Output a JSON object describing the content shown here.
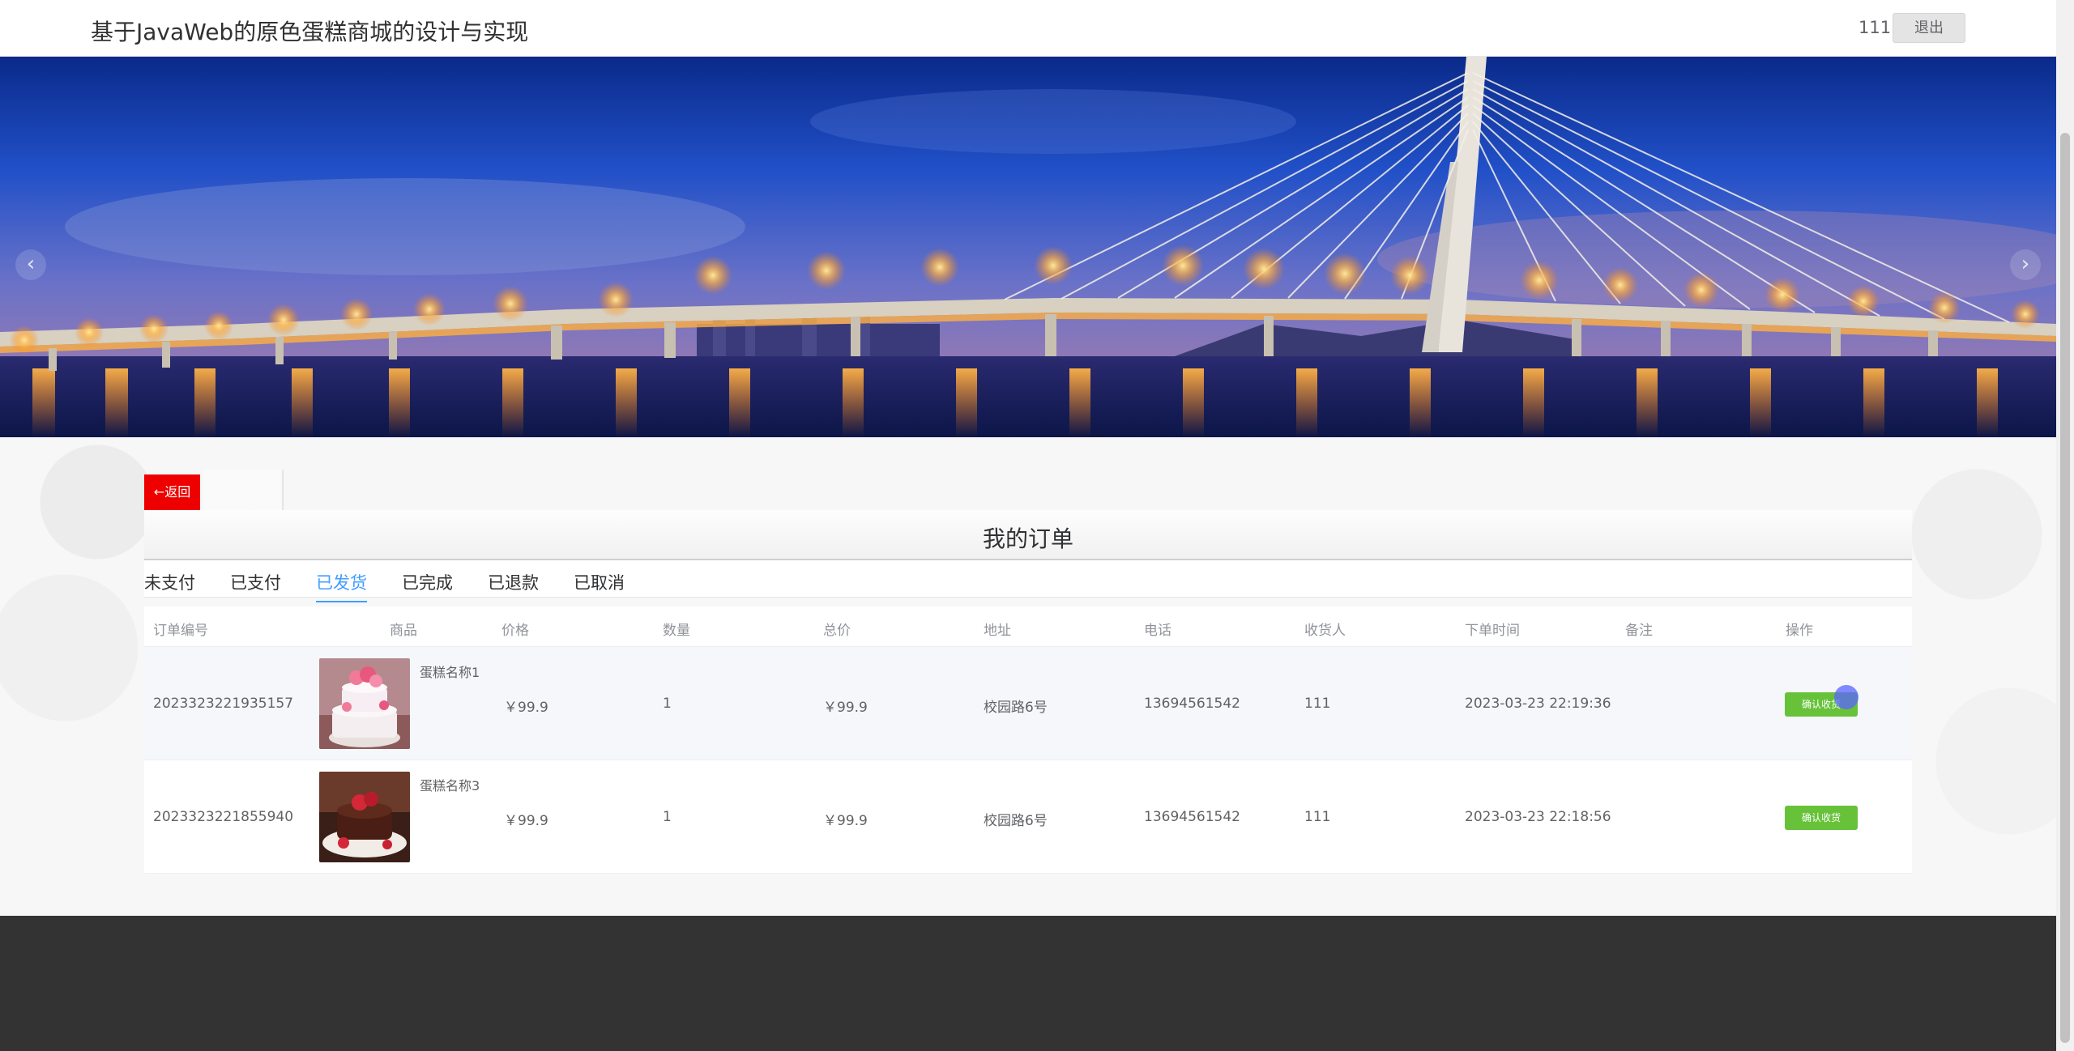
{
  "header": {
    "title": "基于JavaWeb的原色蛋糕商城的设计与实现",
    "username": "111",
    "logout_label": "退出"
  },
  "banner": {
    "prev_icon": "chevron-left-icon",
    "next_icon": "chevron-right-icon",
    "prev_glyph": "‹",
    "next_glyph": "›"
  },
  "back_label": "←返回",
  "panel_title": "我的订单",
  "tabs": [
    "未支付",
    "已支付",
    "已发货",
    "已完成",
    "已退款",
    "已取消"
  ],
  "active_tab": "已发货",
  "table": {
    "headers": [
      "订单编号",
      "商品",
      "价格",
      "数量",
      "总价",
      "地址",
      "电话",
      "收货人",
      "下单时间",
      "备注",
      "操作"
    ],
    "rows": [
      {
        "order_no": "2023323221935157",
        "product": "蛋糕名称1",
        "price": "￥99.9",
        "qty": "1",
        "total": "￥99.9",
        "address": "校园路6号",
        "phone": "13694561542",
        "receiver": "111",
        "time": "2023-03-23 22:19:36",
        "remark": "",
        "action": "确认收货"
      },
      {
        "order_no": "2023323221855940",
        "product": "蛋糕名称3",
        "price": "￥99.9",
        "qty": "1",
        "total": "￥99.9",
        "address": "校园路6号",
        "phone": "13694561542",
        "receiver": "111",
        "time": "2023-03-23 22:18:56",
        "remark": "",
        "action": "确认收货"
      }
    ]
  },
  "colors": {
    "accent": "#409eff",
    "back_button": "#ee0000",
    "confirm_button": "#67c23a",
    "footer": "#333333"
  }
}
